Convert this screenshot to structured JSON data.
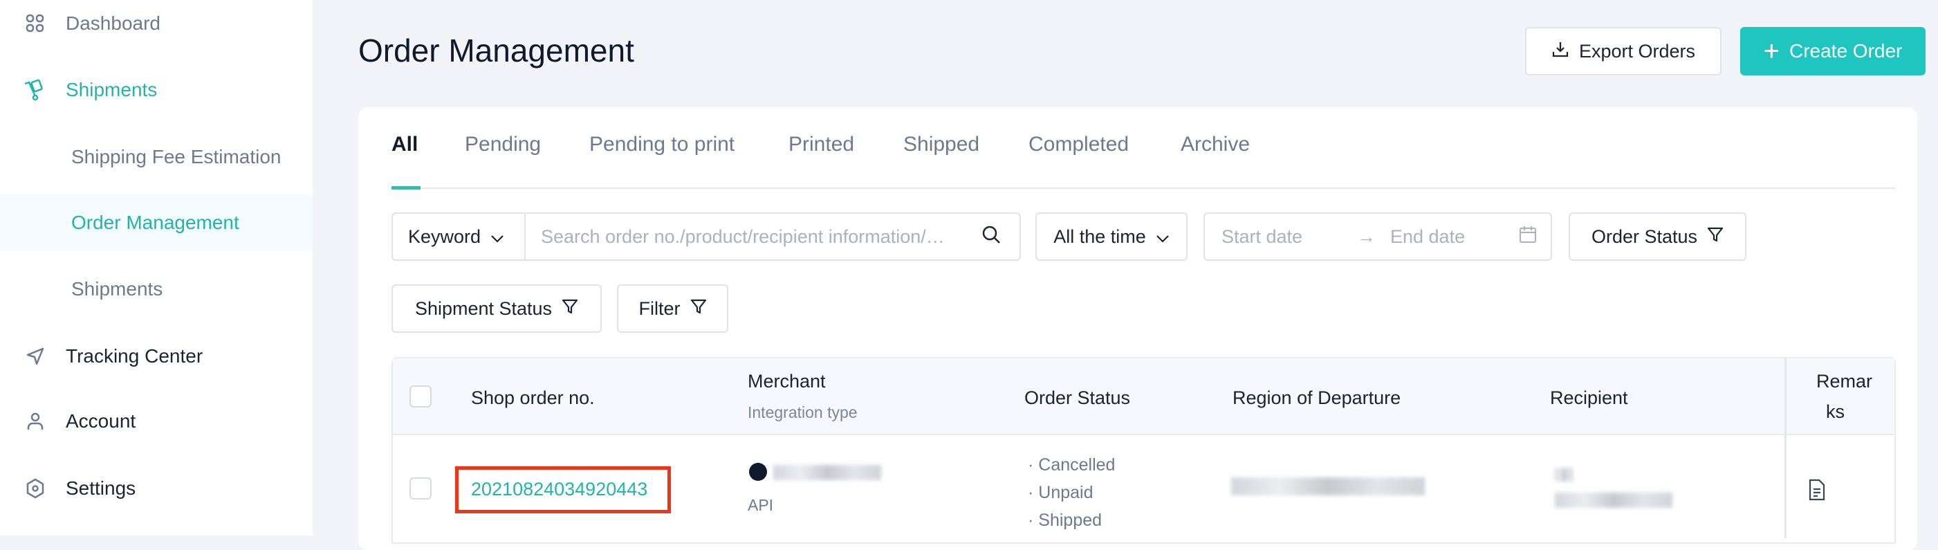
{
  "sidebar": {
    "items": [
      {
        "label": "Dashboard",
        "icon": "grid-icon"
      },
      {
        "label": "Shipments",
        "icon": "cart-icon",
        "expanded": true
      },
      {
        "label": "Shipping Fee Estimation"
      },
      {
        "label": "Order Management",
        "active": true
      },
      {
        "label": "Shipments"
      },
      {
        "label": "Tracking Center",
        "icon": "send-icon"
      },
      {
        "label": "Account",
        "icon": "user-icon"
      },
      {
        "label": "Settings",
        "icon": "settings-icon"
      }
    ]
  },
  "header": {
    "title": "Order Management",
    "export_label": "Export Orders",
    "create_label": "Create Order"
  },
  "tabs": [
    "All",
    "Pending",
    "Pending to print",
    "Printed",
    "Shipped",
    "Completed",
    "Archive"
  ],
  "filters": {
    "keyword_select": "Keyword",
    "search_placeholder": "Search order no./product/recipient information/…",
    "time_select": "All the time",
    "start_placeholder": "Start date",
    "end_placeholder": "End date",
    "order_status": "Order Status",
    "shipment_status": "Shipment Status",
    "filter": "Filter"
  },
  "table": {
    "headers": {
      "shop_order": "Shop order no.",
      "merchant": "Merchant",
      "integration": "Integration type",
      "order_status": "Order Status",
      "region": "Region of Departure",
      "recipient": "Recipient",
      "remarks_1": "Remar",
      "remarks_2": "ks"
    },
    "rows": [
      {
        "order_no": "20210824034920443",
        "integration": "API",
        "statuses": [
          "Cancelled",
          "Unpaid",
          "Shipped"
        ]
      }
    ]
  },
  "colors": {
    "accent": "#1fb5ad",
    "highlight": "#f0341a"
  }
}
